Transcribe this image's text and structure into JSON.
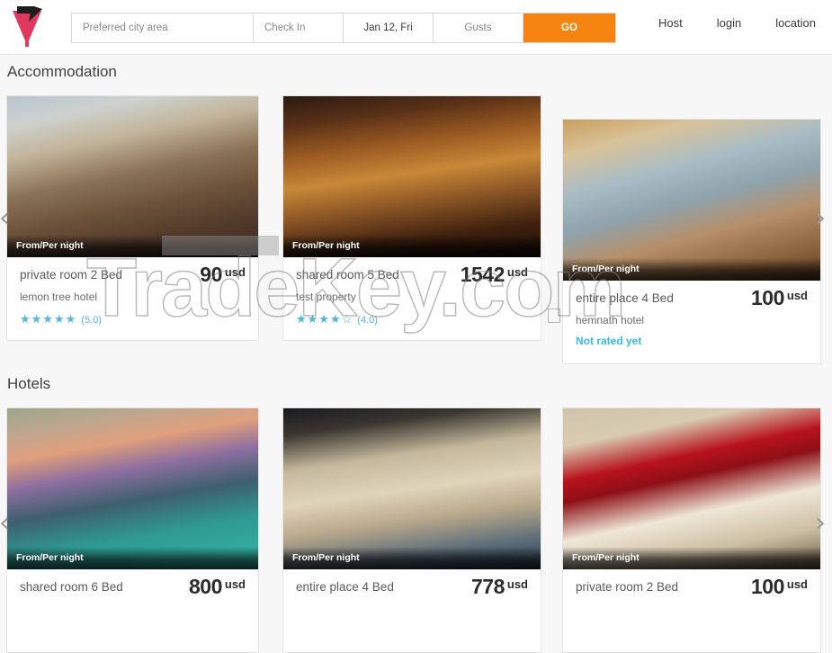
{
  "header": {
    "logo_name": "tradekey-v-logo",
    "search": {
      "city_placeholder": "Preferred city area",
      "checkin_placeholder": "Check In",
      "checkout_value": "Jan 12, Fri",
      "guests_placeholder": "Gusts",
      "go_label": "GO"
    },
    "nav": [
      {
        "label": "Host"
      },
      {
        "label": "login"
      },
      {
        "label": "location"
      }
    ]
  },
  "watermark": {
    "text": "TradeKey.com"
  },
  "sections": [
    {
      "id": "accommodation",
      "title": "Accommodation",
      "badge_label": "From/Per night",
      "cards": [
        {
          "type": "private room 2 Bed",
          "name": "lemon tree hotel",
          "rating": 5.0,
          "rating_label": "(5.0)",
          "stars_filled": 5,
          "rated": true,
          "price": "90",
          "currency": "usd"
        },
        {
          "type": "shared room 5 Bed",
          "name": "test property",
          "rating": 4.0,
          "rating_label": "(4.0)",
          "stars_filled": 4,
          "rated": true,
          "price": "1542",
          "currency": "usd"
        },
        {
          "type": "entire place 4 Bed",
          "name": "hemnath hotel",
          "rating": null,
          "rating_label": "Not rated yet",
          "stars_filled": 0,
          "rated": false,
          "price": "100",
          "currency": "usd"
        }
      ]
    },
    {
      "id": "hotels",
      "title": "Hotels",
      "badge_label": "From/Per night",
      "cards": [
        {
          "type": "shared room 6 Bed",
          "name": "",
          "rating": null,
          "rating_label": "",
          "stars_filled": 0,
          "rated": false,
          "price": "800",
          "currency": "usd"
        },
        {
          "type": "entire place 4 Bed",
          "name": "",
          "rating": null,
          "rating_label": "",
          "stars_filled": 0,
          "rated": false,
          "price": "778",
          "currency": "usd"
        },
        {
          "type": "private room 2 Bed",
          "name": "",
          "rating": null,
          "rating_label": "",
          "stars_filled": 0,
          "rated": false,
          "price": "100",
          "currency": "usd"
        }
      ]
    }
  ],
  "carousel": {
    "prev_icon": "chevron-left-icon",
    "next_icon": "chevron-right-icon"
  },
  "colors": {
    "accent_orange": "#f58410",
    "star_blue": "#4fb8dd",
    "not_rated_blue": "#33bce4",
    "page_bg": "#f7f7f7",
    "logo_pink": "#e8486b"
  }
}
